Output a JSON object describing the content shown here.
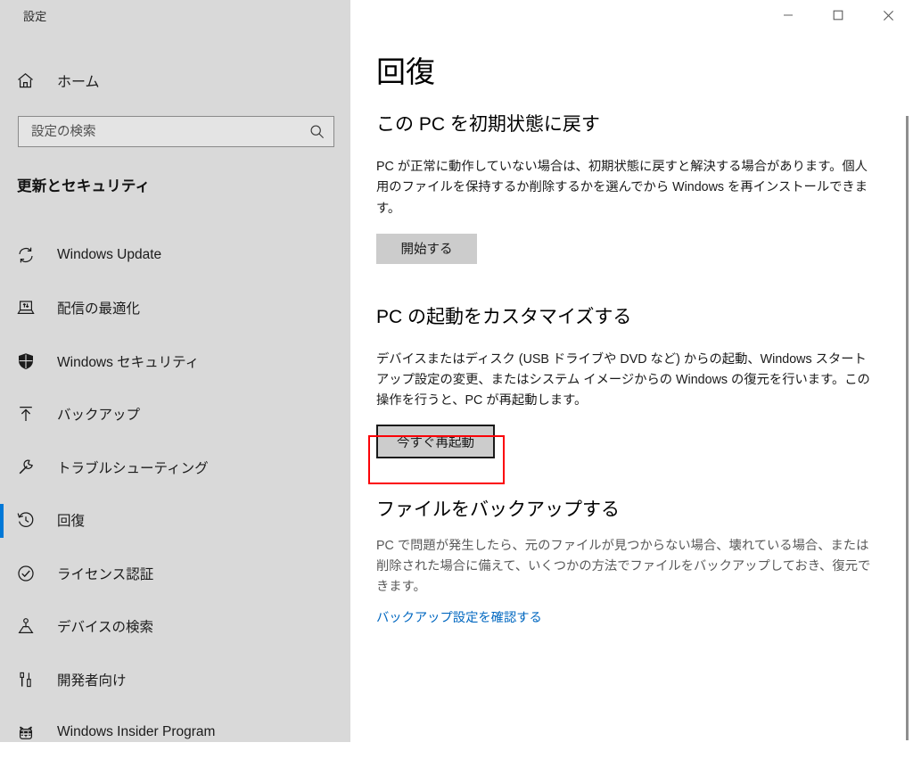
{
  "window": {
    "app_title": "設定",
    "caption_buttons": [
      {
        "name": "minimize-button",
        "glyph": "minimize-icon"
      },
      {
        "name": "maximize-button",
        "glyph": "maximize-icon"
      },
      {
        "name": "close-button",
        "glyph": "close-icon"
      }
    ]
  },
  "sidebar": {
    "home_label": "ホーム",
    "home_icon": "home-icon",
    "search": {
      "placeholder": "設定の検索",
      "value": "",
      "icon": "search-icon"
    },
    "group_title": "更新とセキュリティ",
    "items": [
      {
        "label": "Windows Update",
        "icon": "sync-icon",
        "selected": false
      },
      {
        "label": "配信の最適化",
        "icon": "delivery-optimization-icon",
        "selected": false
      },
      {
        "label": "Windows セキュリティ",
        "icon": "shield-icon",
        "selected": false
      },
      {
        "label": "バックアップ",
        "icon": "backup-upload-icon",
        "selected": false
      },
      {
        "label": "トラブルシューティング",
        "icon": "wrench-icon",
        "selected": false
      },
      {
        "label": "回復",
        "icon": "recovery-clock-icon",
        "selected": true
      },
      {
        "label": "ライセンス認証",
        "icon": "check-circle-icon",
        "selected": false
      },
      {
        "label": "デバイスの検索",
        "icon": "find-device-icon",
        "selected": false
      },
      {
        "label": "開発者向け",
        "icon": "developer-tools-icon",
        "selected": false
      },
      {
        "label": "Windows Insider Program",
        "icon": "ninjacat-icon",
        "selected": false
      }
    ]
  },
  "main": {
    "page_title": "回復",
    "sections": [
      {
        "title": "この PC を初期状態に戻す",
        "body": "PC が正常に動作していない場合は、初期状態に戻すと解決する場合があります。個人用のファイルを保持するか削除するかを選んでから Windows を再インストールできます。",
        "button": "開始する"
      },
      {
        "title": "PC の起動をカスタマイズする",
        "body": "デバイスまたはディスク (USB ドライブや DVD など) からの起動、Windows スタートアップ設定の変更、またはシステム イメージからの Windows の復元を行います。この操作を行うと、PC が再起動します。",
        "button": "今すぐ再起動"
      },
      {
        "title": "ファイルをバックアップする",
        "body": "PC で問題が発生したら、元のファイルが見つからない場合、壊れている場合、または削除された場合に備えて、いくつかの方法でファイルをバックアップしておき、復元できます。",
        "link": "バックアップ設定を確認する"
      }
    ]
  },
  "colors": {
    "accent": "#0078d7",
    "sidebar_bg": "#d9d9d9",
    "content_bg": "#ffffff",
    "link": "#0067c0",
    "highlight": "#fb0007",
    "button_bg": "#cccccc"
  }
}
